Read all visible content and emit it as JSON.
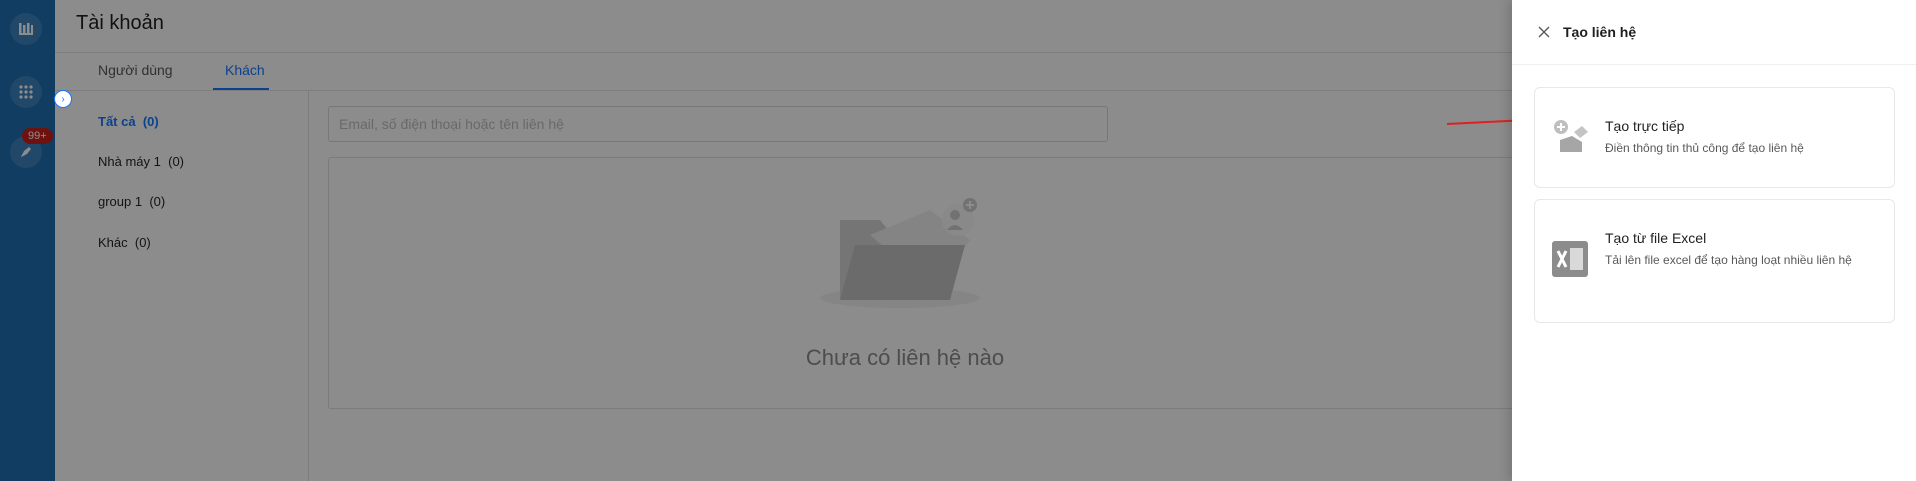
{
  "sidebar_rail": {
    "logo_icon": "app-logo-icon",
    "apps_icon": "grid-icon",
    "notifications_icon": "rocket-icon",
    "notifications_badge": "99+"
  },
  "page": {
    "title": "Tài khoản",
    "tabs": [
      {
        "label": "Người dùng",
        "active": false
      },
      {
        "label": "Khách",
        "active": true
      }
    ]
  },
  "groups": [
    {
      "label": "Tất cả",
      "count": "(0)",
      "active": true
    },
    {
      "label": "Nhà máy 1",
      "count": "(0)",
      "active": false
    },
    {
      "label": "group 1",
      "count": "(0)",
      "active": false
    },
    {
      "label": "Khác",
      "count": "(0)",
      "active": false
    }
  ],
  "search": {
    "placeholder": "Email, số điện thoại hoặc tên liên hệ",
    "value": ""
  },
  "empty_state": {
    "icon": "empty-folder-icon",
    "text": "Chưa có liên hệ nào"
  },
  "drawer": {
    "title": "Tạo liên hệ",
    "close_icon": "close-icon",
    "options": [
      {
        "title": "Tạo trực tiếp",
        "description": "Điền thông tin thủ công để tạo liên hệ",
        "icon": "edit-person-icon"
      },
      {
        "title": "Tạo từ file Excel",
        "description": "Tải lên file excel để tạo hàng loạt nhiều liên hệ",
        "icon": "excel-icon"
      }
    ]
  },
  "colors": {
    "rail": "#1f6fb2",
    "accent": "#1677ff",
    "badge": "#c9211e",
    "annotation_arrow": "#e02020"
  }
}
